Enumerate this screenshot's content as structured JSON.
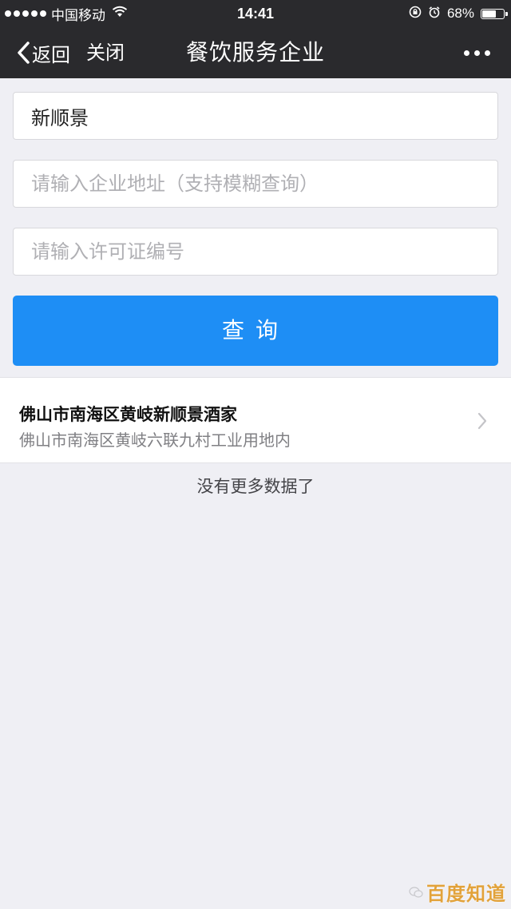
{
  "status_bar": {
    "carrier": "中国移动",
    "time": "14:41",
    "battery_percent": "68%",
    "battery_level": 0.68,
    "icons": [
      "signal-dots-icon",
      "wifi-icon",
      "lock-rotation-icon",
      "alarm-icon",
      "battery-icon"
    ]
  },
  "nav": {
    "back_label": "返回",
    "close_label": "关闭",
    "title": "餐饮服务企业",
    "more_icon": "more-dots-icon"
  },
  "form": {
    "name_value": "新顺景",
    "address_placeholder": "请输入企业地址（支持模糊查询）",
    "license_placeholder": "请输入许可证编号",
    "query_label": "查询"
  },
  "results": [
    {
      "name": "佛山市南海区黄岐新顺景酒家",
      "address": "佛山市南海区黄岐六联九村工业用地内"
    }
  ],
  "footer": {
    "no_more_text": "没有更多数据了"
  },
  "watermark": {
    "logo_text": "百度知道"
  },
  "colors": {
    "bar_background": "#2a2a2d",
    "page_background": "#efeff4",
    "primary_button": "#1e8ef5"
  }
}
